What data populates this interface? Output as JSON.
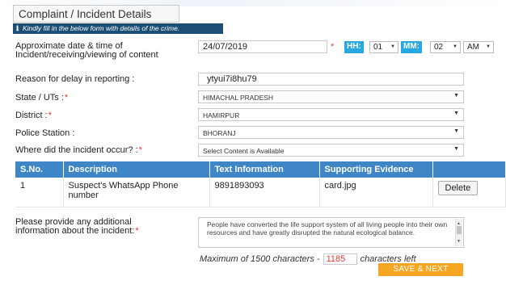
{
  "section": {
    "title": "Complaint / Incident Details",
    "info": "Kindly fill in the below form with details of the crime."
  },
  "datetime": {
    "label": "Approximate date & time of Incident/receiving/viewing of content",
    "required_mark": "*",
    "date_value": "24/07/2019",
    "hh_label": "HH:",
    "hh_value": "01",
    "mm_label": "MM:",
    "mm_value": "02",
    "ampm_value": "AM"
  },
  "delay": {
    "label": "Reason for delay in reporting :",
    "value": "ytyui7i8hu79"
  },
  "state": {
    "label": "State / UTs :",
    "required_mark": "*",
    "value": "HIMACHAL PRADESH"
  },
  "district": {
    "label": "District :",
    "required_mark": "*",
    "value": "HAMIRPUR"
  },
  "police": {
    "label": "Police Station :",
    "value": "BHORANJ"
  },
  "incident_place": {
    "label": "Where did the incident occur? :",
    "required_mark": "*",
    "value": "Select Content is Available"
  },
  "evidence_table": {
    "headers": [
      "S.No.",
      "Description",
      "Text Information",
      "Supporting Evidence",
      ""
    ],
    "rows": [
      {
        "sno": "1",
        "description": "Suspect's WhatsApp Phone number",
        "text_information": "9891893093",
        "evidence": "card.jpg",
        "action_label": "Delete"
      }
    ]
  },
  "additional": {
    "label": "Please provide any additional information about the incident:",
    "required_mark": "*",
    "value": "People have converted the life support system of all living people into their own resources and have greatly disrupted the natural ecological balance."
  },
  "char_limit": {
    "prefix": "Maximum of 1500 characters -",
    "remaining": "1185",
    "suffix": "characters left"
  },
  "save_button": "SAVE & NEXT",
  "icons": {
    "info": "info-icon",
    "caret": "chevron-down-icon",
    "scroll_up": "arrow-up-icon",
    "scroll_down": "arrow-down-icon"
  },
  "colors": {
    "info_bar": "#1d4e74",
    "table_header": "#3f86c6",
    "time_tag": "#27a8e0",
    "required": "#e53935",
    "save_button": "#f5a623"
  }
}
